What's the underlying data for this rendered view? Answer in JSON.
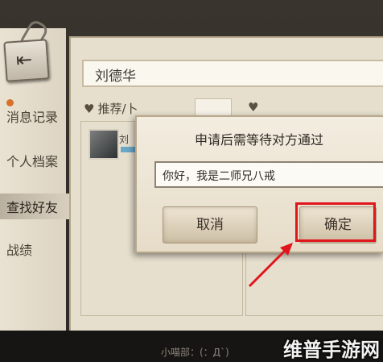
{
  "nav": {
    "items": [
      {
        "label": "消息记录"
      },
      {
        "label": "个人档案"
      },
      {
        "label": "查找好友"
      },
      {
        "label": "战绩"
      }
    ]
  },
  "search": {
    "value": "刘德华"
  },
  "recommend": {
    "label": "推荐/卜",
    "right_label": ""
  },
  "friend": {
    "name": "刘"
  },
  "dialog": {
    "title": "申请后需等待对方通过",
    "input_value": "你好，我是二师兄八戒",
    "cancel_label": "取消",
    "confirm_label": "确定"
  },
  "bottom": {
    "text": "小喵部：(：Д`)"
  },
  "watermark": "维普手游网",
  "colors": {
    "highlight": "#e0161c",
    "arrow": "#e0161c",
    "notify_dot": "#d8722a"
  }
}
